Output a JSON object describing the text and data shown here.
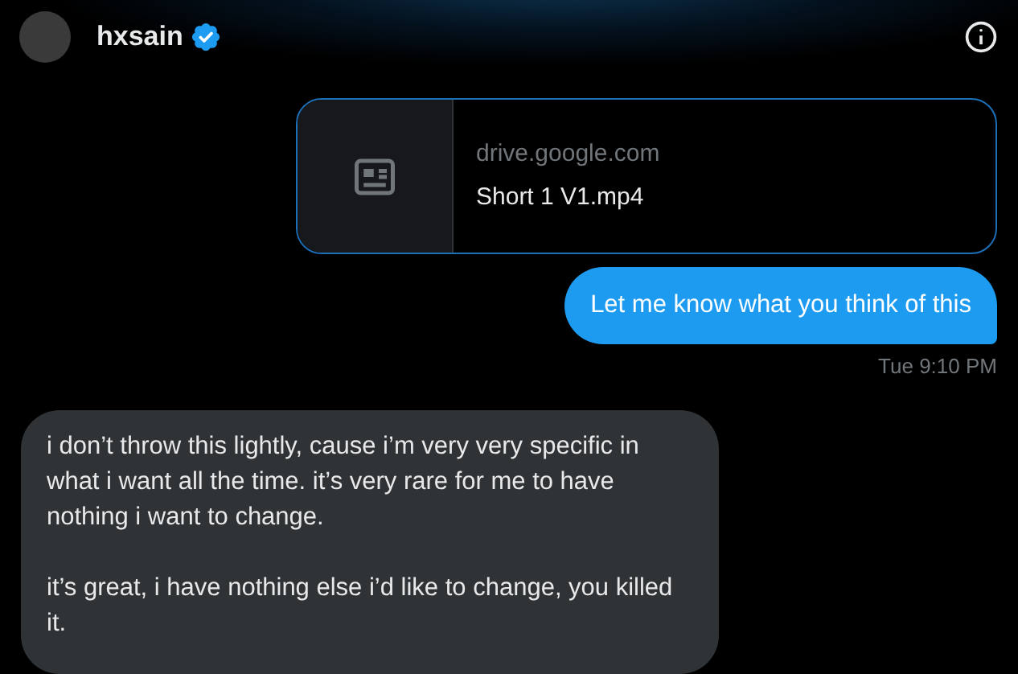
{
  "header": {
    "name": "hxsain",
    "verified": true
  },
  "messages": [
    {
      "kind": "link_card",
      "outgoing": true,
      "domain": "drive.google.com",
      "title": "Short 1 V1.mp4"
    },
    {
      "kind": "text",
      "outgoing": true,
      "paragraphs": [
        "Let me know what you think of this"
      ]
    },
    {
      "kind": "timestamp",
      "text": "Tue 9:10 PM"
    },
    {
      "kind": "text",
      "outgoing": false,
      "paragraphs": [
        "i don’t throw this lightly, cause i’m very very specific in what i want all the time. it’s very rare for me to have nothing i want to change.",
        "it’s great, i have nothing else i’d like to change, you killed it."
      ]
    }
  ]
}
